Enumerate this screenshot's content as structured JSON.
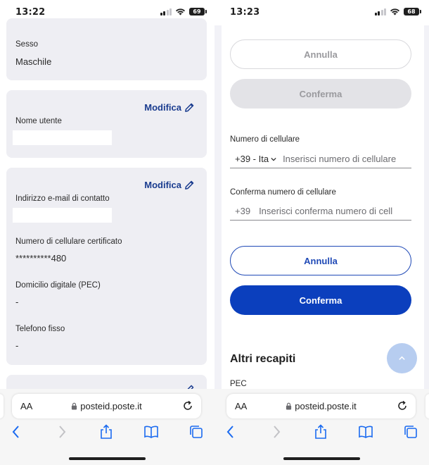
{
  "left": {
    "time": "13:22",
    "battery": "69",
    "profile": {
      "sesso_label": "Sesso",
      "sesso_value": "Maschile",
      "modifica_label": "Modifica",
      "nome_utente_label": "Nome utente",
      "email_label": "Indirizzo e-mail di contatto",
      "cellulare_label": "Numero di cellulare certificato",
      "cellulare_value": "**********480",
      "pec_label": "Domicilio digitale (PEC)",
      "pec_value": "-",
      "telefono_label": "Telefono fisso",
      "telefono_value": "-"
    },
    "browser": {
      "aa": "AA",
      "url": "posteid.poste.it"
    }
  },
  "right": {
    "time": "13:23",
    "battery": "68",
    "form": {
      "annulla_label": "Annulla",
      "conferma_label": "Conferma",
      "numero_label": "Numero di cellulare",
      "prefix_select": "+39 - Ita",
      "numero_placeholder": "Inserisci numero di cellulare",
      "conferma_numero_label": "Conferma numero di cellulare",
      "conferma_prefix": "+39",
      "conferma_placeholder": "Inserisci conferma numero di cellulare",
      "altri_recapiti": "Altri recapiti",
      "pec_label": "PEC"
    },
    "browser": {
      "aa": "AA",
      "url": "posteid.poste.it"
    }
  },
  "colors": {
    "accent_blue": "#0b3fbd",
    "link_blue": "#1a3c8f",
    "card_bg": "#eeeef3",
    "fab_bg": "#b7cdf0"
  },
  "icons": [
    "pencil-icon",
    "lock-icon",
    "reload-icon",
    "back-icon",
    "forward-icon",
    "share-icon",
    "bookmarks-icon",
    "tabs-icon",
    "chevron-up-icon",
    "chevron-down-icon",
    "wifi-icon",
    "signal-icon",
    "battery-icon"
  ]
}
